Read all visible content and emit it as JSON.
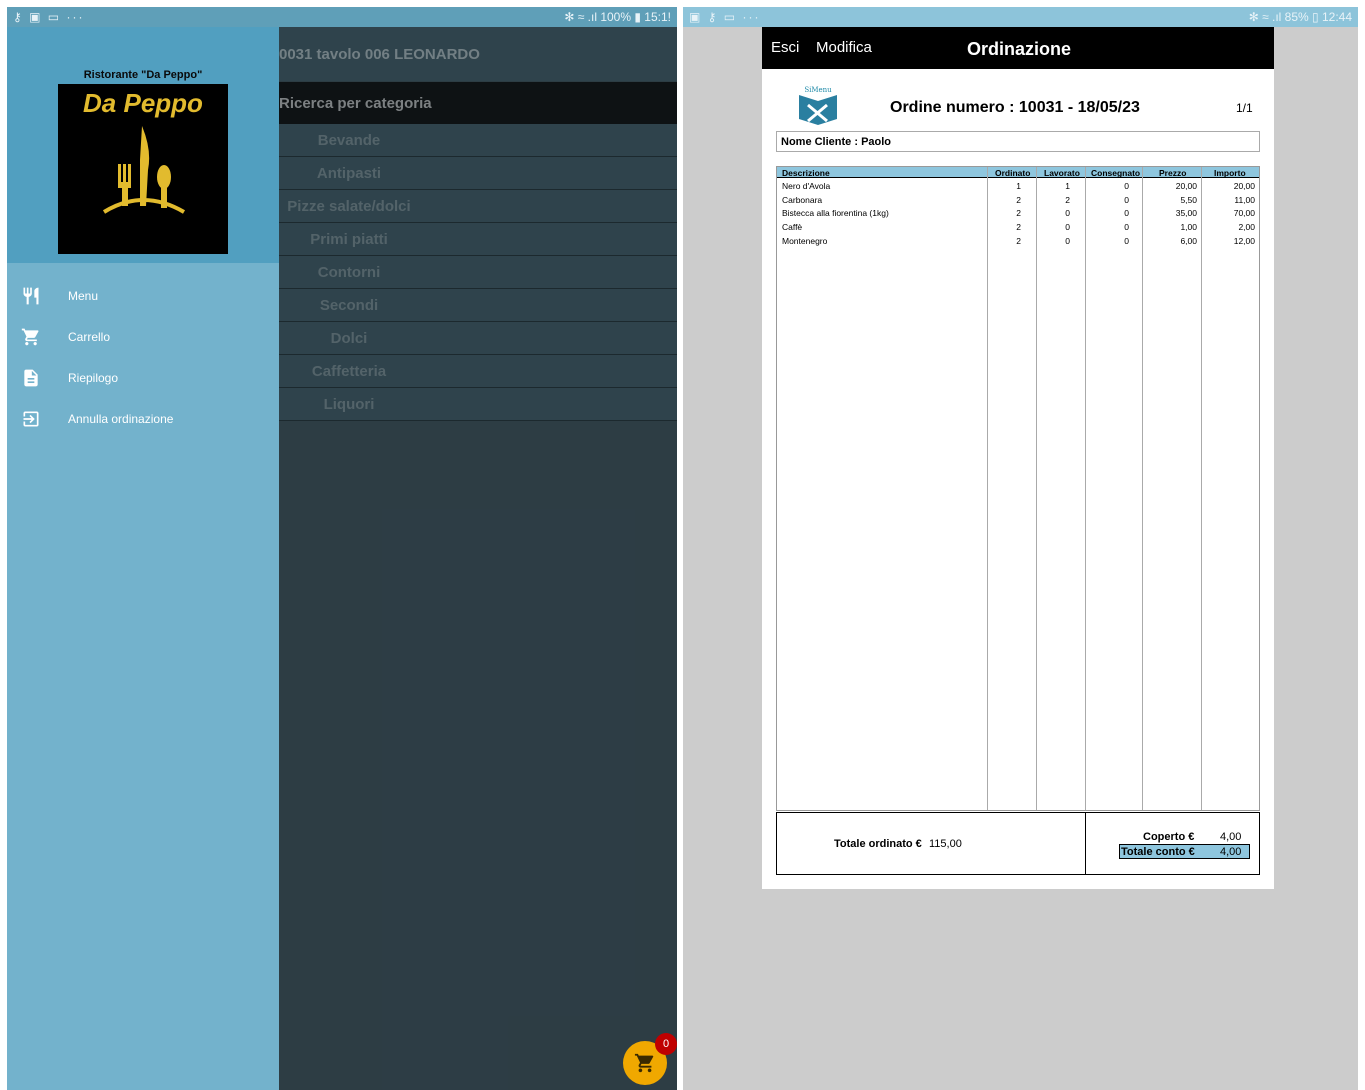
{
  "left_status": {
    "left_icons": "⚷ ▣ ▭ ···",
    "right_text": "✻ ≈ .ıl 100% ▮ 15:1!"
  },
  "right_status": {
    "left_icons": "▣ ⚷ ▭ ···",
    "right_text": "✻ ≈ .ıl 85% ▯ 12:44"
  },
  "main": {
    "title": "0031 tavolo 006 LEONARDO",
    "search_label": "Ricerca per categoria",
    "categories": [
      "Bevande",
      "Antipasti",
      "Pizze salate/dolci",
      "Primi piatti",
      "Contorni",
      "Secondi",
      "Dolci",
      "Caffetteria",
      "Liquori"
    ]
  },
  "drawer": {
    "restaurant_name": "Ristorante \"Da Peppo\"",
    "logo_text": "Da Peppo",
    "items": [
      {
        "label": "Menu",
        "icon": "restaurant-icon"
      },
      {
        "label": "Carrello",
        "icon": "cart-icon"
      },
      {
        "label": "Riepilogo",
        "icon": "document-icon"
      },
      {
        "label": "Annulla ordinazione",
        "icon": "exit-icon"
      }
    ]
  },
  "cart": {
    "count": "0"
  },
  "order": {
    "topbar": {
      "exit": "Esci",
      "edit": "Modifica",
      "title": "Ordinazione"
    },
    "logo_text": "SiMenu",
    "order_title": "Ordine numero : 10031 - 18/05/23",
    "page": "1/1",
    "customer": "Nome Cliente : Paolo",
    "columns": [
      "Descrizione",
      "Ordinato",
      "Lavorato",
      "Consegnato",
      "Prezzo",
      "Importo"
    ],
    "rows": [
      [
        "Nero d'Avola",
        "1",
        "1",
        "0",
        "20,00",
        "20,00"
      ],
      [
        "Carbonara",
        "2",
        "2",
        "0",
        "5,50",
        "11,00"
      ],
      [
        "Bistecca alla fiorentina (1kg)",
        "2",
        "0",
        "0",
        "35,00",
        "70,00"
      ],
      [
        "Caffè",
        "2",
        "0",
        "0",
        "1,00",
        "2,00"
      ],
      [
        "Montenegro",
        "2",
        "0",
        "0",
        "6,00",
        "12,00"
      ]
    ],
    "totals": {
      "ordered_label": "Totale ordinato €",
      "ordered_value": "115,00",
      "cover_label": "Coperto €",
      "cover_value": "4,00",
      "total_label": "Totale conto €",
      "total_value": "4,00"
    }
  },
  "colors": {
    "drawer": "#73b2cc",
    "drawer_header": "#519fc0",
    "accent_header": "#8ec6de",
    "logo_gold": "#e2bb2e"
  }
}
